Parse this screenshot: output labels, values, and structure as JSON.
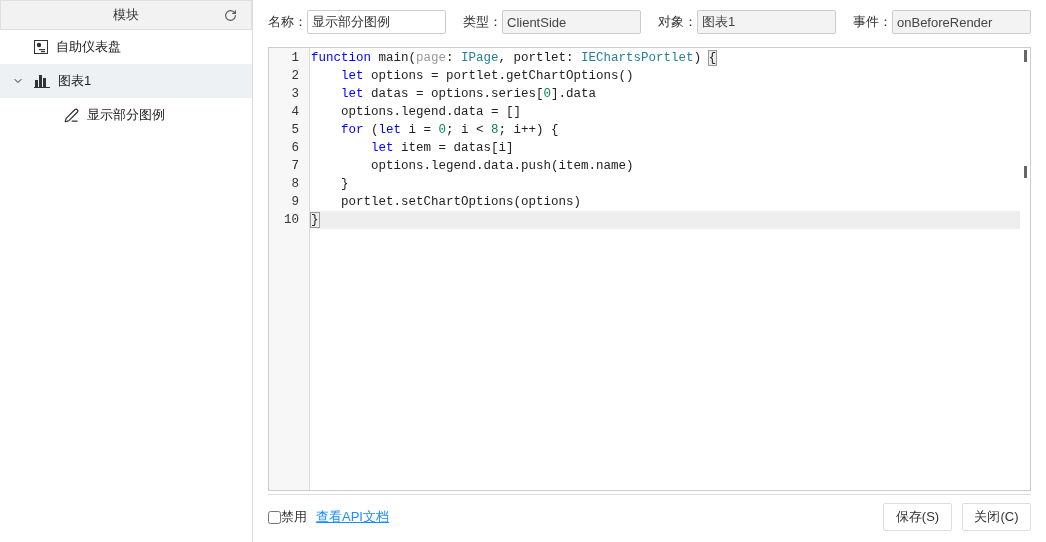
{
  "sidebar": {
    "header": "模块",
    "items": [
      {
        "label": "自助仪表盘",
        "kind": "dashboard",
        "selected": false
      },
      {
        "label": "图表1",
        "kind": "chart",
        "selected": true,
        "expanded": true,
        "children": [
          {
            "label": "显示部分图例",
            "kind": "script",
            "selected": false
          }
        ]
      }
    ]
  },
  "fields": [
    {
      "label": "名称：",
      "value": "显示部分图例",
      "readonly": false
    },
    {
      "label": "类型：",
      "value": "ClientSide",
      "readonly": true
    },
    {
      "label": "对象：",
      "value": "图表1",
      "readonly": true
    },
    {
      "label": "事件：",
      "value": "onBeforeRender",
      "readonly": true
    }
  ],
  "editor": {
    "lines": [
      {
        "number": "1",
        "current": false,
        "tokens": [
          {
            "kind": "kw",
            "text": "function"
          },
          {
            "kind": "plain",
            "text": " main("
          },
          {
            "kind": "param",
            "text": "page"
          },
          {
            "kind": "plain",
            "text": ": "
          },
          {
            "kind": "type",
            "text": "IPage"
          },
          {
            "kind": "plain",
            "text": ", portlet: "
          },
          {
            "kind": "type",
            "text": "IEChartsPortlet"
          },
          {
            "kind": "plain",
            "text": ") "
          },
          {
            "kind": "bracket",
            "text": "{"
          }
        ]
      },
      {
        "number": "2",
        "current": false,
        "tokens": [
          {
            "kind": "kw",
            "text": "    let"
          },
          {
            "kind": "plain",
            "text": " options = portlet.getChartOptions()"
          }
        ]
      },
      {
        "number": "3",
        "current": false,
        "tokens": [
          {
            "kind": "kw",
            "text": "    let"
          },
          {
            "kind": "plain",
            "text": " datas = options.series["
          },
          {
            "kind": "num",
            "text": "0"
          },
          {
            "kind": "plain",
            "text": "].data"
          }
        ]
      },
      {
        "number": "4",
        "current": false,
        "tokens": [
          {
            "kind": "plain",
            "text": "    options.legend.data = []"
          }
        ]
      },
      {
        "number": "5",
        "current": false,
        "tokens": [
          {
            "kind": "kw",
            "text": "    for"
          },
          {
            "kind": "plain",
            "text": " ("
          },
          {
            "kind": "kw",
            "text": "let"
          },
          {
            "kind": "plain",
            "text": " i = "
          },
          {
            "kind": "num",
            "text": "0"
          },
          {
            "kind": "plain",
            "text": "; i < "
          },
          {
            "kind": "num",
            "text": "8"
          },
          {
            "kind": "plain",
            "text": "; i++) {"
          }
        ]
      },
      {
        "number": "6",
        "current": false,
        "tokens": [
          {
            "kind": "kw",
            "text": "        let"
          },
          {
            "kind": "plain",
            "text": " item = datas[i]"
          }
        ]
      },
      {
        "number": "7",
        "current": false,
        "tokens": [
          {
            "kind": "plain",
            "text": "        options.legend.data.push(item.name)"
          }
        ]
      },
      {
        "number": "8",
        "current": false,
        "tokens": [
          {
            "kind": "plain",
            "text": "    }"
          }
        ]
      },
      {
        "number": "9",
        "current": false,
        "tokens": [
          {
            "kind": "plain",
            "text": "    portlet.setChartOptions(options)"
          }
        ]
      },
      {
        "number": "10",
        "current": true,
        "tokens": [
          {
            "kind": "bracket",
            "text": "}"
          }
        ]
      }
    ]
  },
  "footer": {
    "checkbox": {
      "label": "禁用",
      "checked": false
    },
    "link": "查看API文档",
    "buttons": [
      "保存(S)",
      "关闭(C)"
    ]
  }
}
